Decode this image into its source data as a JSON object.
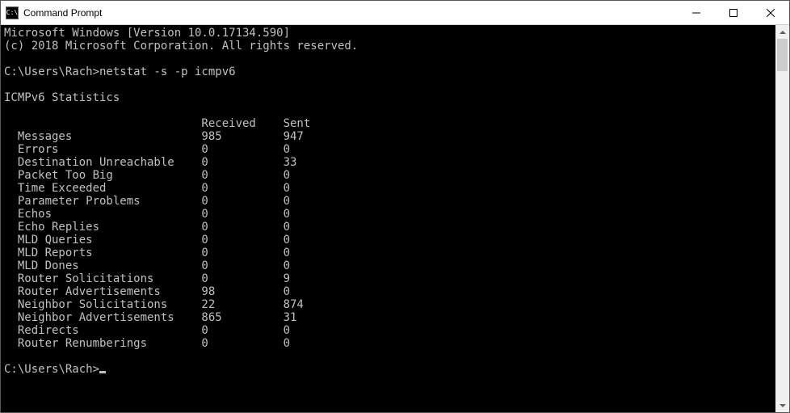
{
  "window": {
    "title": "Command Prompt",
    "icon_label": "C:\\"
  },
  "banner": {
    "line1": "Microsoft Windows [Version 10.0.17134.590]",
    "line2": "(c) 2018 Microsoft Corporation. All rights reserved."
  },
  "prompt1": {
    "path": "C:\\Users\\Rach>",
    "command": "netstat -s -p icmpv6"
  },
  "section_title": "ICMPv6 Statistics",
  "columns": {
    "received": "Received",
    "sent": "Sent"
  },
  "rows": [
    {
      "label": "Messages",
      "received": "985",
      "sent": "947"
    },
    {
      "label": "Errors",
      "received": "0",
      "sent": "0"
    },
    {
      "label": "Destination Unreachable",
      "received": "0",
      "sent": "33"
    },
    {
      "label": "Packet Too Big",
      "received": "0",
      "sent": "0"
    },
    {
      "label": "Time Exceeded",
      "received": "0",
      "sent": "0"
    },
    {
      "label": "Parameter Problems",
      "received": "0",
      "sent": "0"
    },
    {
      "label": "Echos",
      "received": "0",
      "sent": "0"
    },
    {
      "label": "Echo Replies",
      "received": "0",
      "sent": "0"
    },
    {
      "label": "MLD Queries",
      "received": "0",
      "sent": "0"
    },
    {
      "label": "MLD Reports",
      "received": "0",
      "sent": "0"
    },
    {
      "label": "MLD Dones",
      "received": "0",
      "sent": "0"
    },
    {
      "label": "Router Solicitations",
      "received": "0",
      "sent": "9"
    },
    {
      "label": "Router Advertisements",
      "received": "98",
      "sent": "0"
    },
    {
      "label": "Neighbor Solicitations",
      "received": "22",
      "sent": "874"
    },
    {
      "label": "Neighbor Advertisements",
      "received": "865",
      "sent": "31"
    },
    {
      "label": "Redirects",
      "received": "0",
      "sent": "0"
    },
    {
      "label": "Router Renumberings",
      "received": "0",
      "sent": "0"
    }
  ],
  "prompt2": {
    "path": "C:\\Users\\Rach>"
  }
}
